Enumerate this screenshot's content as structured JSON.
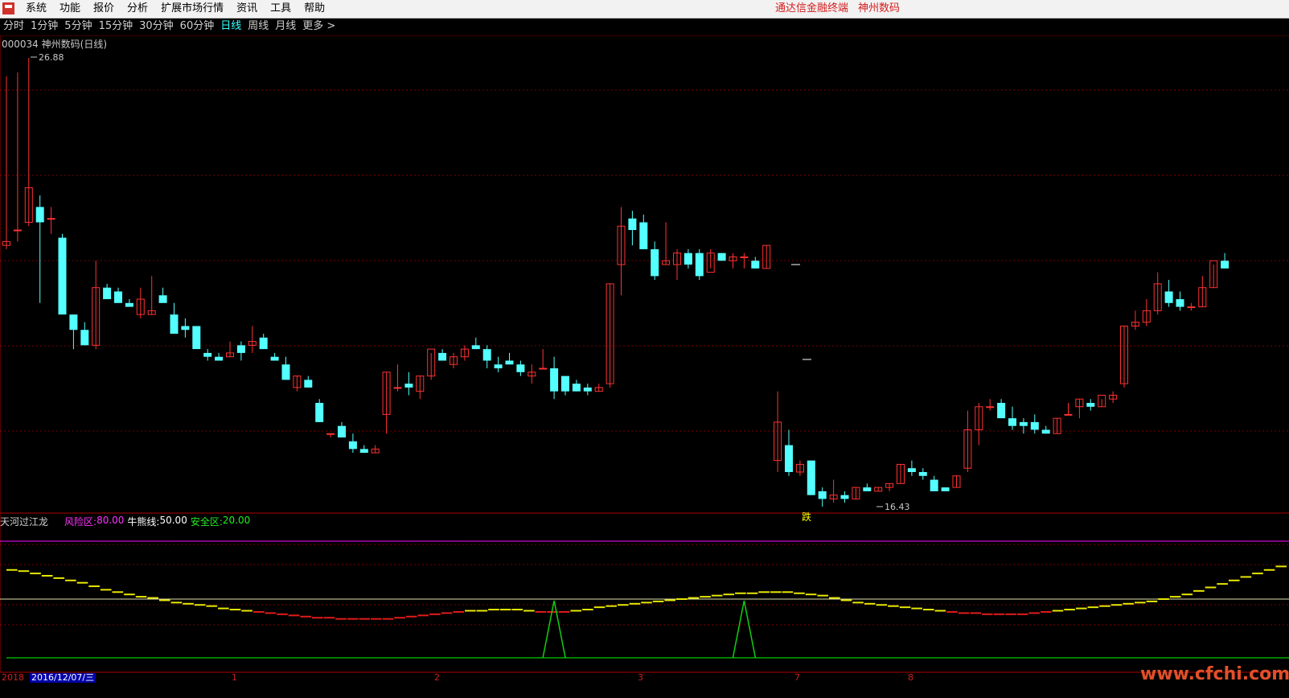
{
  "menubar": {
    "items": [
      "系统",
      "功能",
      "报价",
      "分析",
      "扩展市场行情",
      "资讯",
      "工具",
      "帮助"
    ],
    "right": [
      "通达信金融终端",
      "神州数码"
    ]
  },
  "periods": [
    "分时",
    "1分钟",
    "5分钟",
    "15分钟",
    "30分钟",
    "60分钟",
    "日线",
    "周线",
    "月线",
    "更多 >"
  ],
  "active_period": "日线",
  "stock": {
    "code": "000034",
    "name": "神州数码",
    "period_label": "(日线)"
  },
  "main_chart": {
    "high_label": "26.88",
    "low_label": "16.43",
    "signal_label": "跌"
  },
  "indicator": {
    "name": "天河过江龙",
    "risk_label": "风险区:",
    "risk_value": "80.00",
    "bull_label": "牛熊线:",
    "bull_value": "50.00",
    "safe_label": "安全区:",
    "safe_value": "20.00"
  },
  "date_axis": {
    "year": "2018",
    "cursor_date": "2016/12/07/三",
    "month_labels": [
      "1",
      "2",
      "3",
      "7",
      "8"
    ]
  },
  "watermark": "www.cfchi.com",
  "colors": {
    "up": "#ff3232",
    "down": "#54ffff",
    "risk": "#ff00ff",
    "bull": "#ffffff",
    "safe": "#00ff00"
  },
  "chart_data": {
    "type": "candlestick",
    "candles": [
      {
        "o": 22.0,
        "h": 26.4,
        "l": 21.9,
        "c": 22.1
      },
      {
        "o": 22.4,
        "h": 26.5,
        "l": 22.1,
        "c": 22.4
      },
      {
        "o": 22.6,
        "h": 26.88,
        "l": 22.5,
        "c": 23.5
      },
      {
        "o": 23.0,
        "h": 23.3,
        "l": 20.5,
        "c": 22.6
      },
      {
        "o": 22.7,
        "h": 23.0,
        "l": 22.3,
        "c": 22.7
      },
      {
        "o": 22.2,
        "h": 22.3,
        "l": 20.7,
        "c": 20.2
      },
      {
        "o": 20.2,
        "h": 20.2,
        "l": 19.3,
        "c": 19.8
      },
      {
        "o": 19.8,
        "h": 20.0,
        "l": 19.5,
        "c": 19.4
      },
      {
        "o": 19.4,
        "h": 21.6,
        "l": 19.3,
        "c": 20.9
      },
      {
        "o": 20.9,
        "h": 21.0,
        "l": 20.6,
        "c": 20.6
      },
      {
        "o": 20.8,
        "h": 20.9,
        "l": 20.5,
        "c": 20.5
      },
      {
        "o": 20.5,
        "h": 20.6,
        "l": 20.4,
        "c": 20.4
      },
      {
        "o": 20.2,
        "h": 20.9,
        "l": 20.1,
        "c": 20.6
      },
      {
        "o": 20.2,
        "h": 21.2,
        "l": 20.2,
        "c": 20.3
      },
      {
        "o": 20.7,
        "h": 20.9,
        "l": 20.6,
        "c": 20.5
      },
      {
        "o": 20.2,
        "h": 20.5,
        "l": 19.8,
        "c": 19.7
      },
      {
        "o": 19.9,
        "h": 20.1,
        "l": 19.6,
        "c": 19.8
      },
      {
        "o": 19.9,
        "h": 19.9,
        "l": 19.6,
        "c": 19.3
      },
      {
        "o": 19.2,
        "h": 19.3,
        "l": 19.0,
        "c": 19.1
      },
      {
        "o": 19.1,
        "h": 19.2,
        "l": 19.0,
        "c": 19.0
      },
      {
        "o": 19.1,
        "h": 19.5,
        "l": 19.1,
        "c": 19.2
      },
      {
        "o": 19.4,
        "h": 19.5,
        "l": 19.0,
        "c": 19.2
      },
      {
        "o": 19.4,
        "h": 19.9,
        "l": 19.2,
        "c": 19.5
      },
      {
        "o": 19.6,
        "h": 19.7,
        "l": 19.3,
        "c": 19.3
      },
      {
        "o": 19.1,
        "h": 19.2,
        "l": 19.0,
        "c": 19.0
      },
      {
        "o": 18.9,
        "h": 19.1,
        "l": 18.5,
        "c": 18.5
      },
      {
        "o": 18.3,
        "h": 18.6,
        "l": 18.2,
        "c": 18.6
      },
      {
        "o": 18.5,
        "h": 18.6,
        "l": 18.3,
        "c": 18.3
      },
      {
        "o": 17.9,
        "h": 18.0,
        "l": 17.4,
        "c": 17.4
      },
      {
        "o": 17.1,
        "h": 17.1,
        "l": 17.0,
        "c": 17.1
      },
      {
        "o": 17.3,
        "h": 17.4,
        "l": 17.0,
        "c": 17.0
      },
      {
        "o": 16.9,
        "h": 17.1,
        "l": 16.6,
        "c": 16.7
      },
      {
        "o": 16.7,
        "h": 16.8,
        "l": 16.6,
        "c": 16.6
      },
      {
        "o": 16.6,
        "h": 16.8,
        "l": 16.6,
        "c": 16.7
      },
      {
        "o": 17.6,
        "h": 18.7,
        "l": 17.1,
        "c": 18.7
      },
      {
        "o": 18.3,
        "h": 18.9,
        "l": 18.2,
        "c": 18.3
      },
      {
        "o": 18.4,
        "h": 18.7,
        "l": 18.1,
        "c": 18.3
      },
      {
        "o": 18.2,
        "h": 18.6,
        "l": 18.0,
        "c": 18.6
      },
      {
        "o": 18.6,
        "h": 19.2,
        "l": 18.5,
        "c": 19.3
      },
      {
        "o": 19.2,
        "h": 19.3,
        "l": 19.1,
        "c": 19.0
      },
      {
        "o": 18.9,
        "h": 19.2,
        "l": 18.8,
        "c": 19.1
      },
      {
        "o": 19.1,
        "h": 19.4,
        "l": 19.0,
        "c": 19.3
      },
      {
        "o": 19.4,
        "h": 19.6,
        "l": 19.3,
        "c": 19.3
      },
      {
        "o": 19.3,
        "h": 19.4,
        "l": 18.8,
        "c": 19.0
      },
      {
        "o": 18.9,
        "h": 19.1,
        "l": 18.7,
        "c": 18.8
      },
      {
        "o": 19.0,
        "h": 19.2,
        "l": 18.9,
        "c": 18.9
      },
      {
        "o": 18.9,
        "h": 19.0,
        "l": 18.6,
        "c": 18.7
      },
      {
        "o": 18.6,
        "h": 18.9,
        "l": 18.4,
        "c": 18.7
      },
      {
        "o": 18.8,
        "h": 19.3,
        "l": 18.8,
        "c": 18.8
      },
      {
        "o": 18.8,
        "h": 19.1,
        "l": 18.0,
        "c": 18.2
      },
      {
        "o": 18.6,
        "h": 18.6,
        "l": 18.1,
        "c": 18.2
      },
      {
        "o": 18.4,
        "h": 18.5,
        "l": 18.2,
        "c": 18.2
      },
      {
        "o": 18.3,
        "h": 18.4,
        "l": 18.1,
        "c": 18.2
      },
      {
        "o": 18.2,
        "h": 18.4,
        "l": 18.2,
        "c": 18.3
      },
      {
        "o": 18.4,
        "h": 21.0,
        "l": 18.3,
        "c": 21.0
      },
      {
        "o": 21.5,
        "h": 23.0,
        "l": 20.7,
        "c": 22.5
      },
      {
        "o": 22.7,
        "h": 22.9,
        "l": 22.0,
        "c": 22.4
      },
      {
        "o": 22.6,
        "h": 22.8,
        "l": 22.1,
        "c": 21.9
      },
      {
        "o": 21.9,
        "h": 22.1,
        "l": 21.1,
        "c": 21.2
      },
      {
        "o": 21.5,
        "h": 22.6,
        "l": 21.5,
        "c": 21.6
      },
      {
        "o": 21.5,
        "h": 21.9,
        "l": 21.1,
        "c": 21.8
      },
      {
        "o": 21.8,
        "h": 21.9,
        "l": 21.4,
        "c": 21.5
      },
      {
        "o": 21.8,
        "h": 21.9,
        "l": 21.1,
        "c": 21.2
      },
      {
        "o": 21.3,
        "h": 21.9,
        "l": 21.4,
        "c": 21.8
      },
      {
        "o": 21.8,
        "h": 21.8,
        "l": 21.6,
        "c": 21.6
      },
      {
        "o": 21.6,
        "h": 21.8,
        "l": 21.4,
        "c": 21.7
      },
      {
        "o": 21.7,
        "h": 21.8,
        "l": 21.4,
        "c": 21.7
      },
      {
        "o": 21.6,
        "h": 21.7,
        "l": 21.4,
        "c": 21.4
      },
      {
        "o": 21.4,
        "h": 22.0,
        "l": 21.4,
        "c": 22.0
      },
      {
        "o": 16.4,
        "h": 18.2,
        "l": 16.1,
        "c": 17.4
      },
      {
        "o": 16.8,
        "h": 17.2,
        "l": 16.0,
        "c": 16.1
      },
      {
        "o": 16.1,
        "h": 16.4,
        "l": 16.0,
        "c": 16.3
      },
      {
        "o": 16.4,
        "h": 16.4,
        "l": 15.5,
        "c": 15.5
      },
      {
        "o": 15.6,
        "h": 15.7,
        "l": 15.2,
        "c": 15.4
      },
      {
        "o": 15.4,
        "h": 15.9,
        "l": 15.3,
        "c": 15.5
      },
      {
        "o": 15.5,
        "h": 15.6,
        "l": 15.3,
        "c": 15.4
      },
      {
        "o": 15.4,
        "h": 15.7,
        "l": 15.4,
        "c": 15.7
      },
      {
        "o": 15.7,
        "h": 15.8,
        "l": 15.6,
        "c": 15.6
      },
      {
        "o": 15.6,
        "h": 15.7,
        "l": 15.6,
        "c": 15.7
      },
      {
        "o": 15.7,
        "h": 15.8,
        "l": 15.6,
        "c": 15.8
      },
      {
        "o": 15.8,
        "h": 16.3,
        "l": 15.8,
        "c": 16.3
      },
      {
        "o": 16.2,
        "h": 16.4,
        "l": 16.0,
        "c": 16.1
      },
      {
        "o": 16.1,
        "h": 16.2,
        "l": 15.9,
        "c": 16.0
      },
      {
        "o": 15.9,
        "h": 16.0,
        "l": 15.7,
        "c": 15.6
      },
      {
        "o": 15.7,
        "h": 15.7,
        "l": 15.6,
        "c": 15.6
      },
      {
        "o": 15.7,
        "h": 16.0,
        "l": 15.7,
        "c": 16.0
      },
      {
        "o": 16.2,
        "h": 17.7,
        "l": 16.1,
        "c": 17.2
      },
      {
        "o": 17.2,
        "h": 17.9,
        "l": 16.8,
        "c": 17.8
      },
      {
        "o": 17.8,
        "h": 18.0,
        "l": 17.7,
        "c": 17.8
      },
      {
        "o": 17.9,
        "h": 18.0,
        "l": 17.6,
        "c": 17.5
      },
      {
        "o": 17.5,
        "h": 17.8,
        "l": 17.2,
        "c": 17.3
      },
      {
        "o": 17.4,
        "h": 17.5,
        "l": 17.1,
        "c": 17.3
      },
      {
        "o": 17.4,
        "h": 17.6,
        "l": 17.1,
        "c": 17.2
      },
      {
        "o": 17.2,
        "h": 17.3,
        "l": 17.1,
        "c": 17.1
      },
      {
        "o": 17.1,
        "h": 17.5,
        "l": 17.1,
        "c": 17.5
      },
      {
        "o": 17.6,
        "h": 17.9,
        "l": 17.6,
        "c": 17.6
      },
      {
        "o": 17.8,
        "h": 18.0,
        "l": 17.5,
        "c": 18.0
      },
      {
        "o": 17.9,
        "h": 18.0,
        "l": 17.7,
        "c": 17.8
      },
      {
        "o": 17.8,
        "h": 18.0,
        "l": 17.8,
        "c": 18.1
      },
      {
        "o": 18.0,
        "h": 18.2,
        "l": 17.9,
        "c": 18.1
      },
      {
        "o": 18.4,
        "h": 19.9,
        "l": 18.3,
        "c": 19.9
      },
      {
        "o": 19.9,
        "h": 20.3,
        "l": 19.8,
        "c": 20.0
      },
      {
        "o": 20.0,
        "h": 20.6,
        "l": 19.9,
        "c": 20.3
      },
      {
        "o": 20.3,
        "h": 21.3,
        "l": 20.2,
        "c": 21.0
      },
      {
        "o": 20.8,
        "h": 21.1,
        "l": 20.4,
        "c": 20.5
      },
      {
        "o": 20.6,
        "h": 20.8,
        "l": 20.3,
        "c": 20.4
      },
      {
        "o": 20.4,
        "h": 20.5,
        "l": 20.3,
        "c": 20.4
      },
      {
        "o": 20.4,
        "h": 21.2,
        "l": 20.4,
        "c": 20.9
      },
      {
        "o": 20.9,
        "h": 21.5,
        "l": 20.9,
        "c": 21.6
      },
      {
        "o": 21.6,
        "h": 21.8,
        "l": 21.4,
        "c": 21.4
      }
    ],
    "indicator_levels": {
      "risk": 80,
      "bull": 50,
      "safe": 20
    },
    "indicator_series": {
      "line": [
        75,
        74,
        72,
        70,
        68,
        66,
        64,
        61,
        58,
        56,
        54,
        52,
        51,
        49,
        47,
        46,
        45,
        44,
        42,
        41,
        40,
        39,
        38,
        37,
        36,
        35,
        34,
        34,
        33,
        33,
        33,
        33,
        33,
        34,
        35,
        36,
        37,
        38,
        39,
        40,
        40,
        41,
        41,
        41,
        40,
        39,
        39,
        39,
        40,
        41,
        43,
        44,
        45,
        46,
        47,
        48,
        49,
        50,
        51,
        52,
        53,
        54,
        55,
        55,
        56,
        56,
        56,
        55,
        54,
        53,
        51,
        49,
        47,
        46,
        45,
        44,
        43,
        42,
        41,
        40,
        39,
        38,
        38,
        37,
        37,
        37,
        37,
        38,
        39,
        40,
        41,
        42,
        43,
        44,
        45,
        46,
        47,
        48,
        50,
        52,
        54,
        57,
        60,
        63,
        66,
        69,
        72,
        75,
        78
      ],
      "spikes": [
        49,
        66,
        131,
        134
      ]
    }
  }
}
